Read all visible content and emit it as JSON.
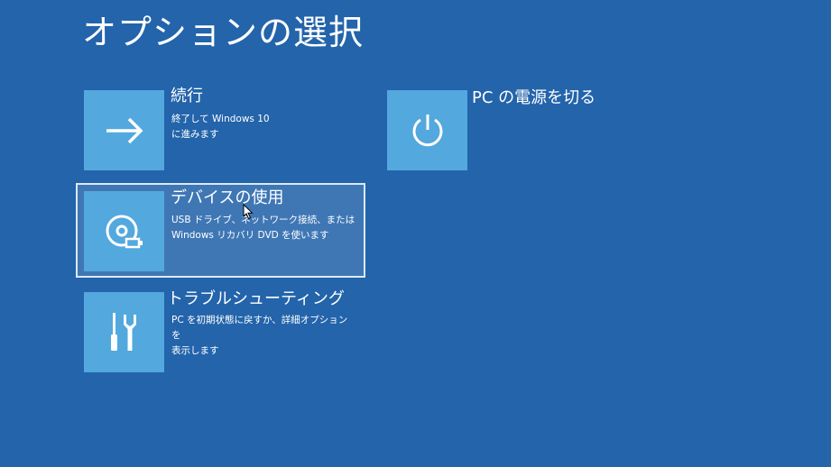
{
  "page": {
    "title": "オプションの選択"
  },
  "options": [
    {
      "id": "continue",
      "label": "続行",
      "description": "終了して Windows 10\nに進みます",
      "icon": "arrow-right-icon"
    },
    {
      "id": "use-device",
      "label": "デバイスの使用",
      "description": "USB ドライブ、ネットワーク接続、または\nWindows リカバリ DVD を使います",
      "icon": "disc-usb-icon",
      "selected": true
    },
    {
      "id": "troubleshoot",
      "label": "トラブルシューティング",
      "description": "PC を初期状態に戻すか、詳細オプションを\n表示します",
      "icon": "screwdriver-wrench-icon"
    },
    {
      "id": "power-off",
      "label": "PC の電源を切る",
      "description": "",
      "icon": "power-icon"
    }
  ],
  "colors": {
    "background": "#2364ab",
    "tile": "#53a8de",
    "selected_background": "#3f77b5",
    "selected_border": "#dce9f6",
    "text": "#ffffff"
  }
}
